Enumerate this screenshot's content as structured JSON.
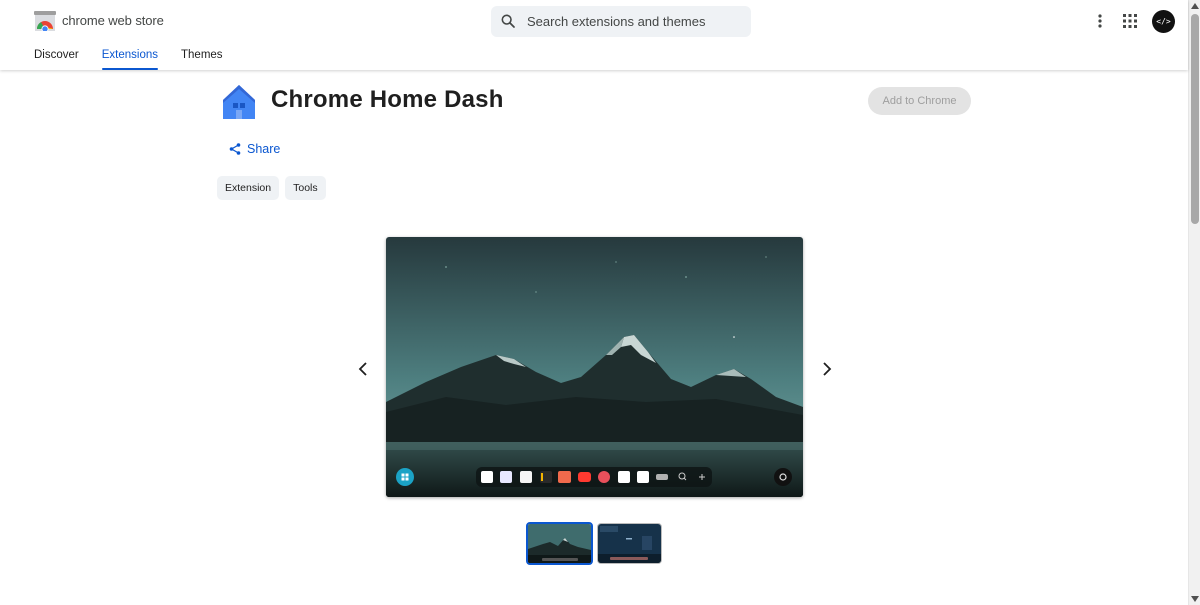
{
  "header": {
    "brand": "chrome web store",
    "search_placeholder": "Search extensions and themes",
    "avatar_text": "</>",
    "nav": [
      {
        "label": "Discover",
        "active": false
      },
      {
        "label": "Extensions",
        "active": true
      },
      {
        "label": "Themes",
        "active": false
      }
    ]
  },
  "extension": {
    "title": "Chrome Home Dash",
    "add_button": "Add to Chrome",
    "share_label": "Share",
    "chips": [
      "Extension",
      "Tools"
    ]
  },
  "carousel": {
    "selected_index": 0,
    "slide_count": 2,
    "dock_icons": [
      "info-icon",
      "slack-icon",
      "notion-icon",
      "file-icon",
      "figma-icon",
      "youtube-icon",
      "pinterest-icon",
      "pause-icon",
      "bag-icon",
      "link-icon",
      "search-icon",
      "plus-icon"
    ]
  },
  "colors": {
    "accent": "#0b57d0",
    "sky_top": "#2e4a4d",
    "sky_bottom": "#6a9e9b",
    "mountain": "#1c2a2a"
  }
}
